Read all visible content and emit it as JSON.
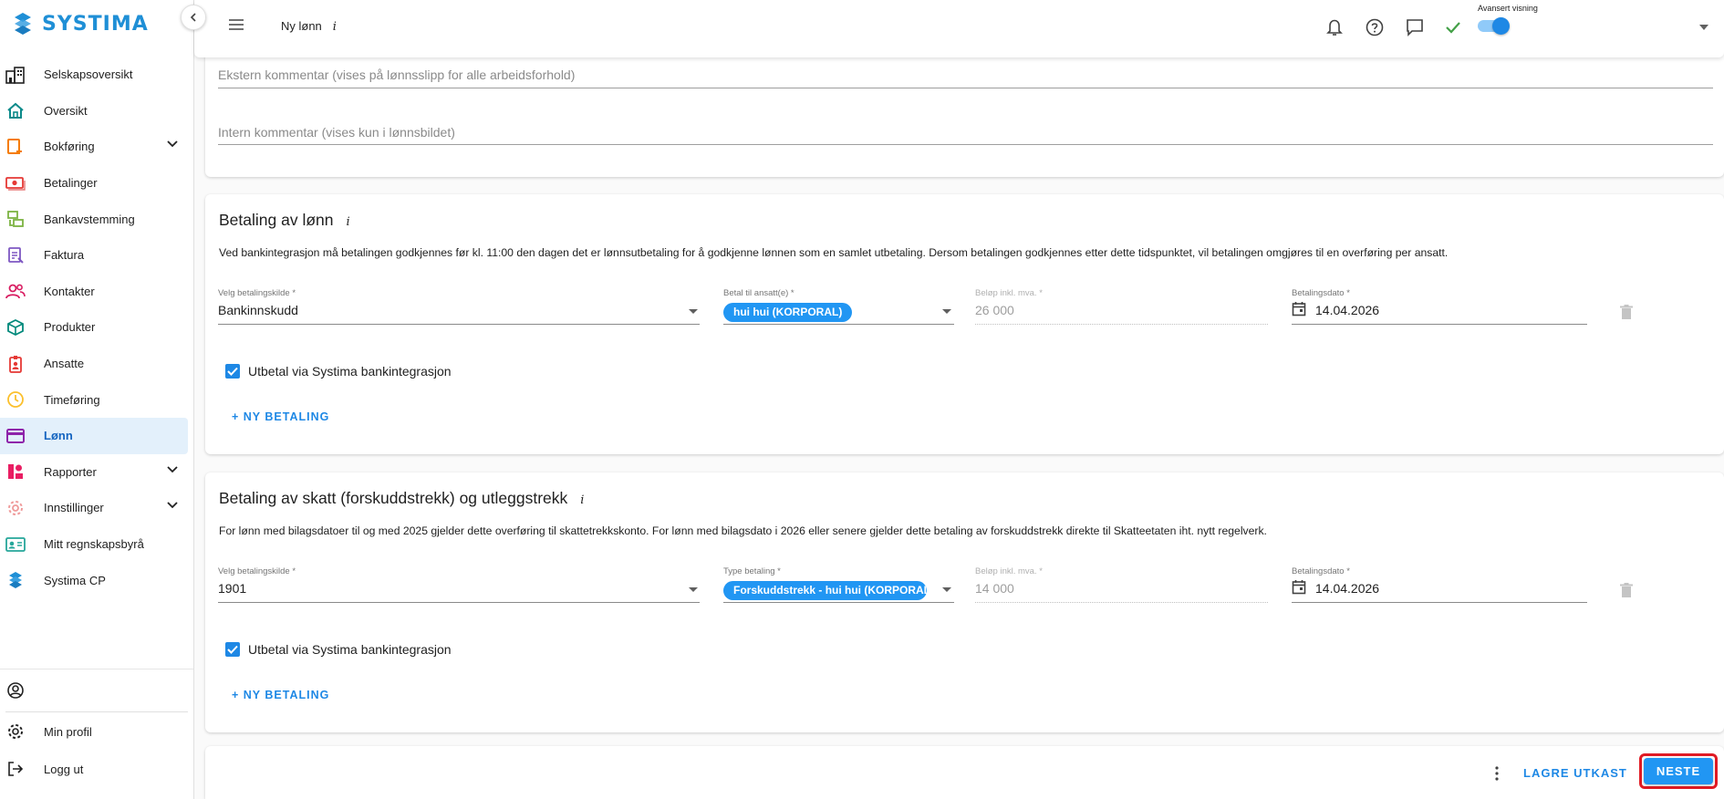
{
  "app": {
    "brand": "SYSTIMA",
    "brand_color": "#1f8fd6",
    "accent": "#2196f3"
  },
  "sidebar": {
    "items": [
      {
        "label": "Selskapsoversikt",
        "icon": "company-overview-icon"
      },
      {
        "label": "Oversikt",
        "icon": "home-icon"
      },
      {
        "label": "Bokføring",
        "icon": "bookkeeping-icon",
        "expandable": true
      },
      {
        "label": "Betalinger",
        "icon": "payments-icon"
      },
      {
        "label": "Bankavstemming",
        "icon": "bank-reconciliation-icon"
      },
      {
        "label": "Faktura",
        "icon": "invoice-icon"
      },
      {
        "label": "Kontakter",
        "icon": "contacts-icon"
      },
      {
        "label": "Produkter",
        "icon": "products-icon"
      },
      {
        "label": "Ansatte",
        "icon": "employees-icon"
      },
      {
        "label": "Timeføring",
        "icon": "clock-icon"
      },
      {
        "label": "Lønn",
        "icon": "payroll-card-icon",
        "active": true
      },
      {
        "label": "Rapporter",
        "icon": "reports-icon",
        "expandable": true
      },
      {
        "label": "Innstillinger",
        "icon": "settings-icon",
        "expandable": true
      },
      {
        "label": "Mitt regnskapsbyrå",
        "icon": "accounting-firm-icon"
      },
      {
        "label": "Systima CP",
        "icon": "systima-cp-icon"
      }
    ],
    "bottom": {
      "profile_label": "Min profil",
      "logout_label": "Logg ut"
    }
  },
  "topbar": {
    "title": "Ny lønn",
    "info": "i",
    "toggle_label": "Avansert visning",
    "toggle_on": true
  },
  "comments": {
    "external_placeholder": "Ekstern kommentar (vises på lønnsslipp for alle arbeidsforhold)",
    "internal_placeholder": "Intern kommentar (vises kun i lønnsbildet)"
  },
  "salary_payment": {
    "title": "Betaling av lønn",
    "info": "i",
    "description": "Ved bankintegrasjon må betalingen godkjennes før kl. 11:00 den dagen det er lønnsutbetaling for å godkjenne lønnen som en samlet utbetaling. Dersom betalingen godkjennes etter dette tidspunktet, vil betalingen omgjøres til en overføring per ansatt.",
    "source_label": "Velg betalingskilde *",
    "source_value": "Bankinnskudd",
    "employee_label": "Betal til ansatt(e) *",
    "employee_chip": "hui hui (KORPORAL)",
    "amount_label": "Beløp inkl. mva. *",
    "amount_value": "26 000",
    "date_label": "Betalingsdato *",
    "date_value": "14.04.2026",
    "checkbox_label": "Utbetal via Systima bankintegrasjon",
    "checkbox_checked": true,
    "new_payment": "+ NY BETALING"
  },
  "tax_payment": {
    "title": "Betaling av skatt (forskuddstrekk) og utleggstrekk",
    "info": "i",
    "description": "For lønn med bilagsdatoer til og med 2025 gjelder dette overføring til skattetrekkskonto. For lønn med bilagsdato i 2026 eller senere gjelder dette betaling av forskuddstrekk direkte til Skatteetaten iht. nytt regelverk.",
    "source_label": "Velg betalingskilde *",
    "source_value": "1901",
    "type_label": "Type betaling *",
    "type_chip": "Forskuddstrekk - hui hui (KORPORAL)",
    "amount_label": "Beløp inkl. mva. *",
    "amount_value": "14 000",
    "date_label": "Betalingsdato *",
    "date_value": "14.04.2026",
    "checkbox_label": "Utbetal via Systima bankintegrasjon",
    "checkbox_checked": true,
    "new_payment": "+ NY BETALING"
  },
  "footer": {
    "save_draft": "LAGRE UTKAST",
    "next": "NESTE",
    "highlight_color": "#e01b24"
  }
}
